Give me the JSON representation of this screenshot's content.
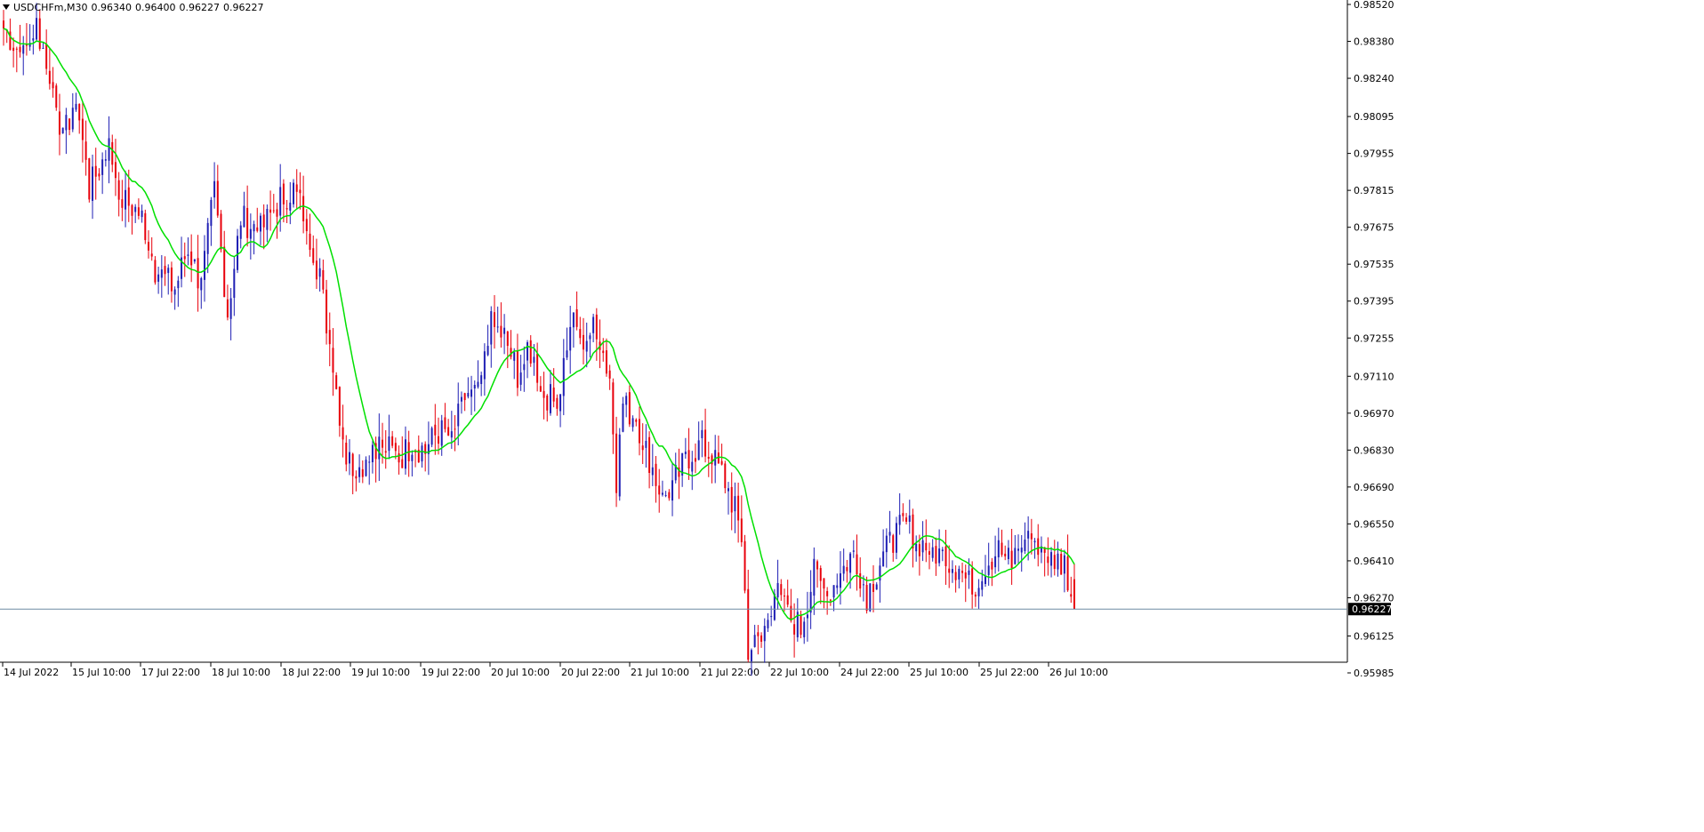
{
  "window": {
    "symbol_title": "USDCHFm,M30",
    "open": "0.96340",
    "high": "0.96400",
    "low": "0.96227",
    "close": "0.96227"
  },
  "colors": {
    "background": "#ffffff",
    "axis": "#000000",
    "up_candle": "#1f1fb4",
    "down_candle": "#e8000b",
    "moving_average": "#00e000",
    "price_line": "#6f8ba3",
    "price_tag_bg": "#000000",
    "price_tag_text": "#ffffff"
  },
  "price_axis": {
    "labels": [
      "0.98520",
      "0.98380",
      "0.98240",
      "0.98095",
      "0.97955",
      "0.97815",
      "0.97675",
      "0.97535",
      "0.97395",
      "0.97255",
      "0.97110",
      "0.96970",
      "0.96830",
      "0.96690",
      "0.96550",
      "0.96410",
      "0.96270",
      "0.96125",
      "0.95985"
    ],
    "current_price": "0.96227"
  },
  "time_axis": {
    "labels": [
      "14 Jul 2022",
      "15 Jul 10:00",
      "17 Jul 22:00",
      "18 Jul 10:00",
      "18 Jul 22:00",
      "19 Jul 10:00",
      "19 Jul 22:00",
      "20 Jul 10:00",
      "20 Jul 22:00",
      "21 Jul 10:00",
      "21 Jul 22:00",
      "22 Jul 10:00",
      "24 Jul 22:00",
      "25 Jul 10:00",
      "25 Jul 22:00",
      "26 Jul 10:00"
    ]
  },
  "chart_data": {
    "type": "candlestick",
    "indicator": "moving average",
    "y_range": [
      0.9591,
      0.9852
    ],
    "anchors": [
      [
        0,
        0.9843
      ],
      [
        6,
        0.9832
      ],
      [
        10,
        0.9845
      ],
      [
        14,
        0.9826
      ],
      [
        18,
        0.98
      ],
      [
        22,
        0.9818
      ],
      [
        26,
        0.9782
      ],
      [
        32,
        0.9798
      ],
      [
        36,
        0.9778
      ],
      [
        42,
        0.9772
      ],
      [
        46,
        0.9752
      ],
      [
        52,
        0.9744
      ],
      [
        56,
        0.976
      ],
      [
        60,
        0.9745
      ],
      [
        64,
        0.9782
      ],
      [
        68,
        0.9735
      ],
      [
        72,
        0.9771
      ],
      [
        78,
        0.9766
      ],
      [
        84,
        0.9778
      ],
      [
        88,
        0.9782
      ],
      [
        92,
        0.977
      ],
      [
        96,
        0.9748
      ],
      [
        100,
        0.9715
      ],
      [
        104,
        0.968
      ],
      [
        108,
        0.9675
      ],
      [
        112,
        0.9686
      ],
      [
        116,
        0.9684
      ],
      [
        120,
        0.968
      ],
      [
        124,
        0.9685
      ],
      [
        128,
        0.9683
      ],
      [
        132,
        0.969
      ],
      [
        136,
        0.9688
      ],
      [
        140,
        0.9702
      ],
      [
        144,
        0.9703
      ],
      [
        148,
        0.973
      ],
      [
        152,
        0.9726
      ],
      [
        156,
        0.9712
      ],
      [
        160,
        0.972
      ],
      [
        164,
        0.9705
      ],
      [
        168,
        0.97
      ],
      [
        172,
        0.9732
      ],
      [
        176,
        0.9725
      ],
      [
        180,
        0.973
      ],
      [
        184,
        0.971
      ],
      [
        186,
        0.9672
      ],
      [
        188,
        0.97
      ],
      [
        192,
        0.9695
      ],
      [
        196,
        0.968
      ],
      [
        200,
        0.9664
      ],
      [
        204,
        0.9672
      ],
      [
        208,
        0.9681
      ],
      [
        212,
        0.9685
      ],
      [
        216,
        0.9678
      ],
      [
        218,
        0.9675
      ],
      [
        222,
        0.966
      ],
      [
        224,
        0.965
      ],
      [
        226,
        0.9608
      ],
      [
        230,
        0.961
      ],
      [
        234,
        0.963
      ],
      [
        238,
        0.962
      ],
      [
        242,
        0.9616
      ],
      [
        246,
        0.9636
      ],
      [
        250,
        0.9628
      ],
      [
        254,
        0.9636
      ],
      [
        258,
        0.9645
      ],
      [
        262,
        0.9628
      ],
      [
        266,
        0.964
      ],
      [
        270,
        0.965
      ],
      [
        274,
        0.9655
      ],
      [
        278,
        0.9648
      ],
      [
        282,
        0.9645
      ],
      [
        286,
        0.9642
      ],
      [
        290,
        0.9638
      ],
      [
        294,
        0.963
      ],
      [
        298,
        0.964
      ],
      [
        302,
        0.9645
      ],
      [
        306,
        0.964
      ],
      [
        310,
        0.9652
      ],
      [
        314,
        0.9648
      ],
      [
        318,
        0.9642
      ],
      [
        322,
        0.964
      ],
      [
        324,
        0.963
      ],
      [
        325,
        0.9623
      ]
    ]
  }
}
